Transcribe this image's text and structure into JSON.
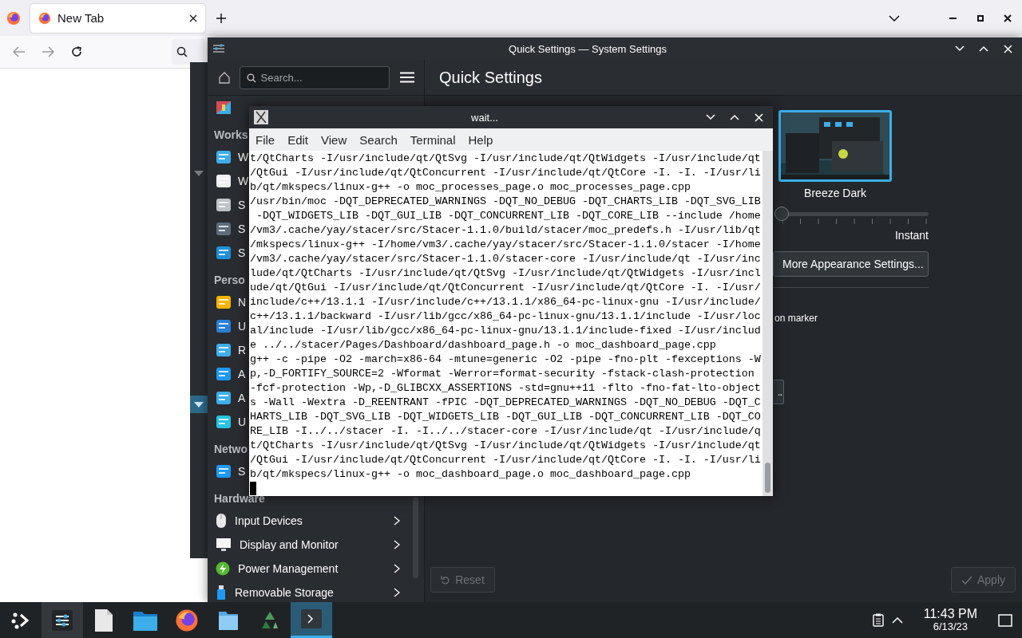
{
  "browser": {
    "tabs": [
      {
        "label": "New Tab",
        "selected": true
      }
    ]
  },
  "settings_window": {
    "title": "Quick Settings — System Settings",
    "search": {
      "placeholder": "Search..."
    },
    "page_title": "Quick Settings",
    "sidebar": [
      {
        "heading": "Works",
        "items": [
          {
            "label": "W",
            "chevron": false
          },
          {
            "label": "W",
            "chevron": false
          },
          {
            "label": "S",
            "chevron": false
          },
          {
            "label": "S",
            "chevron": false
          },
          {
            "label": "S",
            "chevron": false
          }
        ]
      },
      {
        "heading": "Perso",
        "items": [
          {
            "label": "N",
            "chevron": false
          },
          {
            "label": "U",
            "chevron": false
          },
          {
            "label": "R",
            "chevron": false
          },
          {
            "label": "A",
            "chevron": false
          },
          {
            "label": "A",
            "chevron": false
          },
          {
            "label": "U",
            "chevron": false
          }
        ]
      },
      {
        "heading": "Netwo",
        "items": [
          {
            "label": "S",
            "chevron": false
          }
        ]
      },
      {
        "heading": "Hardware",
        "items": [
          {
            "label": "Input Devices",
            "chevron": true
          },
          {
            "label": "Display and Monitor",
            "chevron": true
          },
          {
            "label": "Power Management",
            "chevron": true
          },
          {
            "label": "Removable Storage",
            "chevron": true
          }
        ]
      }
    ],
    "theme": {
      "name": "Breeze Dark",
      "selected": true
    },
    "animation_slider": {
      "level": 0,
      "label": "Instant"
    },
    "more_button": "More Appearance Settings...",
    "partial_text": "on marker",
    "partial_button": "..",
    "buttons": [
      {
        "label": "Reset",
        "kind": "reset",
        "disabled": true
      },
      {
        "label": "Apply",
        "kind": "apply",
        "disabled": true
      }
    ]
  },
  "terminal": {
    "title": "wait...",
    "menu": [
      "File",
      "Edit",
      "View",
      "Search",
      "Terminal",
      "Help"
    ],
    "lines": [
      "t/QtCharts -I/usr/include/qt/QtSvg -I/usr/include/qt/QtWidgets -I/usr/include/qt",
      "/QtGui -I/usr/include/qt/QtConcurrent -I/usr/include/qt/QtCore -I. -I. -I/usr/li",
      "b/qt/mkspecs/linux-g++ -o moc_processes_page.o moc_processes_page.cpp",
      "/usr/bin/moc -DQT_DEPRECATED_WARNINGS -DQT_NO_DEBUG -DQT_CHARTS_LIB -DQT_SVG_LIB",
      " -DQT_WIDGETS_LIB -DQT_GUI_LIB -DQT_CONCURRENT_LIB -DQT_CORE_LIB --include /home",
      "/vm3/.cache/yay/stacer/src/Stacer-1.1.0/build/stacer/moc_predefs.h -I/usr/lib/qt",
      "/mkspecs/linux-g++ -I/home/vm3/.cache/yay/stacer/src/Stacer-1.1.0/stacer -I/home",
      "/vm3/.cache/yay/stacer/src/Stacer-1.1.0/stacer-core -I/usr/include/qt -I/usr/inc",
      "lude/qt/QtCharts -I/usr/include/qt/QtSvg -I/usr/include/qt/QtWidgets -I/usr/incl",
      "ude/qt/QtGui -I/usr/include/qt/QtConcurrent -I/usr/include/qt/QtCore -I. -I/usr/",
      "include/c++/13.1.1 -I/usr/include/c++/13.1.1/x86_64-pc-linux-gnu -I/usr/include/",
      "c++/13.1.1/backward -I/usr/lib/gcc/x86_64-pc-linux-gnu/13.1.1/include -I/usr/loc",
      "al/include -I/usr/lib/gcc/x86_64-pc-linux-gnu/13.1.1/include-fixed -I/usr/includ",
      "e ../../stacer/Pages/Dashboard/dashboard_page.h -o moc_dashboard_page.cpp",
      "g++ -c -pipe -O2 -march=x86-64 -mtune=generic -O2 -pipe -fno-plt -fexceptions -W",
      "p,-D_FORTIFY_SOURCE=2 -Wformat -Werror=format-security -fstack-clash-protection",
      "-fcf-protection -Wp,-D_GLIBCXX_ASSERTIONS -std=gnu++11 -flto -fno-fat-lto-object",
      "s -Wall -Wextra -D_REENTRANT -fPIC -DQT_DEPRECATED_WARNINGS -DQT_NO_DEBUG -DQT_C",
      "HARTS_LIB -DQT_SVG_LIB -DQT_WIDGETS_LIB -DQT_GUI_LIB -DQT_CONCURRENT_LIB -DQT_CO",
      "RE_LIB -I../../stacer -I. -I../../stacer-core -I/usr/include/qt -I/usr/include/q",
      "t/QtCharts -I/usr/include/qt/QtSvg -I/usr/include/qt/QtWidgets -I/usr/include/qt",
      "/QtGui -I/usr/include/qt/QtConcurrent -I/usr/include/qt/QtCore -I. -I. -I/usr/li",
      "b/qt/mkspecs/linux-g++ -o moc_dashboard_page.o moc_dashboard_page.cpp"
    ]
  },
  "taskbar": {
    "items": [
      {
        "kind": "launcher",
        "active": false,
        "focused": false
      },
      {
        "kind": "settings",
        "active": true,
        "focused": false
      },
      {
        "kind": "document",
        "active": false,
        "focused": false
      },
      {
        "kind": "folder",
        "active": false,
        "focused": false
      },
      {
        "kind": "browser",
        "active": false,
        "focused": false
      },
      {
        "kind": "files",
        "active": false,
        "focused": false
      },
      {
        "kind": "recycle",
        "active": false,
        "focused": false
      },
      {
        "kind": "terminal",
        "active": true,
        "focused": true
      }
    ],
    "clock": {
      "time": "11:43 PM",
      "date": "6/13/23"
    }
  }
}
